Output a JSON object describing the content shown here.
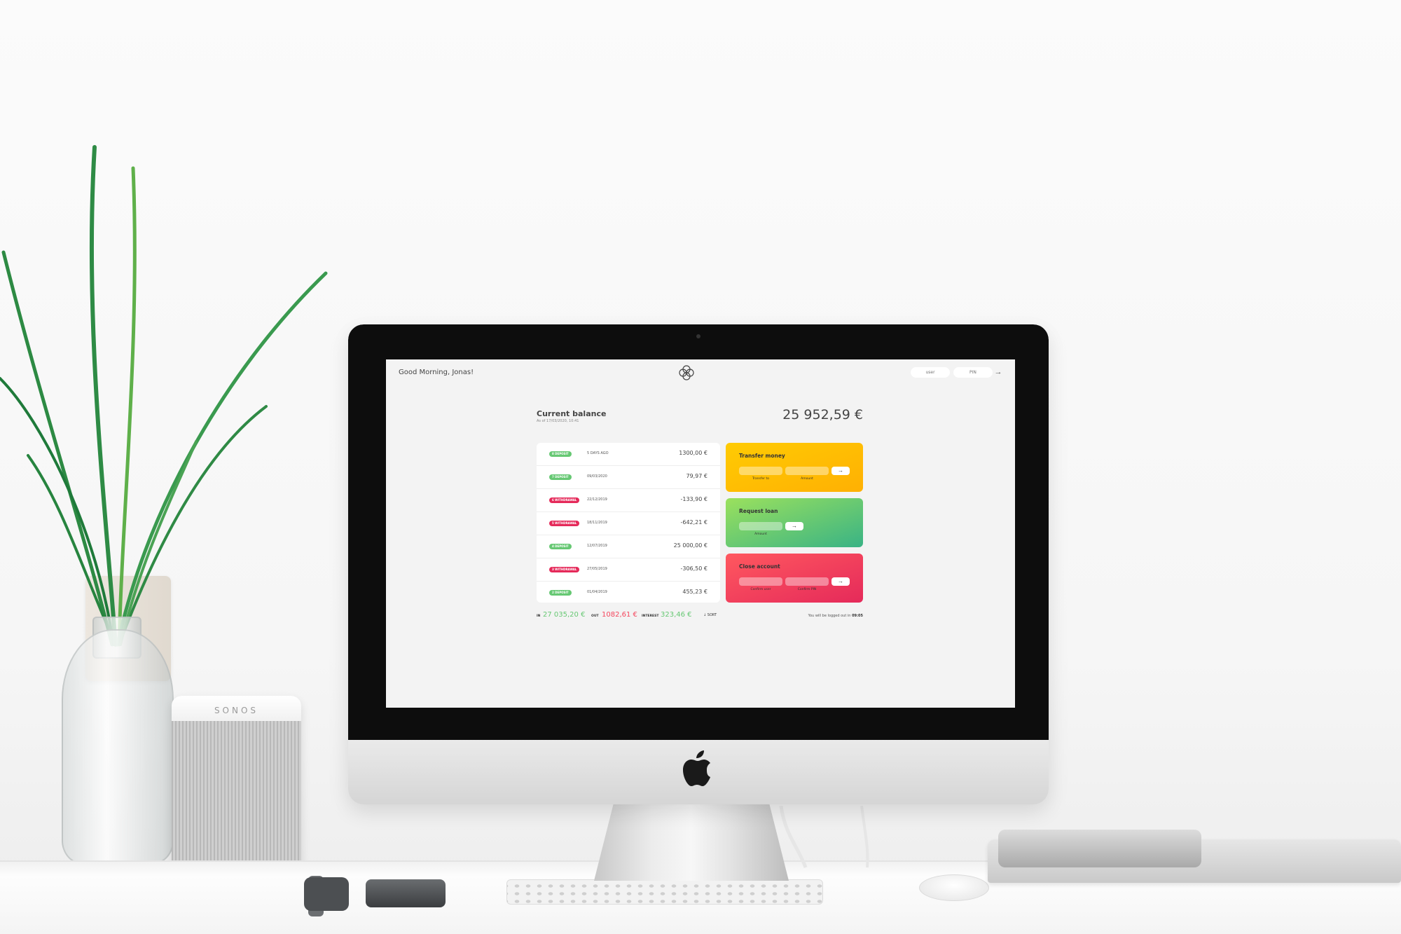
{
  "scene": {
    "speaker_brand": "SONOS"
  },
  "app": {
    "greeting": "Good Morning, Jonas!",
    "login": {
      "user_placeholder": "user",
      "pin_placeholder": "PIN",
      "button_icon": "arrow-right-icon"
    },
    "balance": {
      "label": "Current balance",
      "date": "As of 17/03/2020, 10:41",
      "value": "25 952,59 €"
    },
    "movements": [
      {
        "type": "8 DEPOSIT",
        "kind": "deposit",
        "date": "5 DAYS AGO",
        "value": "1300,00 €"
      },
      {
        "type": "7 DEPOSIT",
        "kind": "deposit",
        "date": "09/03/2020",
        "value": "79,97 €"
      },
      {
        "type": "6 WITHDRAWAL",
        "kind": "withdrawal",
        "date": "22/12/2019",
        "value": "-133,90 €"
      },
      {
        "type": "5 WITHDRAWAL",
        "kind": "withdrawal",
        "date": "18/11/2019",
        "value": "-642,21 €"
      },
      {
        "type": "4 DEPOSIT",
        "kind": "deposit",
        "date": "12/07/2019",
        "value": "25 000,00 €"
      },
      {
        "type": "3 WITHDRAWAL",
        "kind": "withdrawal",
        "date": "27/05/2019",
        "value": "-306,50 €"
      },
      {
        "type": "2 DEPOSIT",
        "kind": "deposit",
        "date": "01/04/2019",
        "value": "455,23 €"
      }
    ],
    "operations": {
      "transfer": {
        "title": "Transfer money",
        "label_to": "Transfer to",
        "label_amount": "Amount"
      },
      "loan": {
        "title": "Request loan",
        "label_amount": "Amount"
      },
      "close": {
        "title": "Close account",
        "label_user": "Confirm user",
        "label_pin": "Confirm PIN"
      }
    },
    "summary": {
      "in_label": "IN",
      "in_value": "27 035,20 €",
      "out_label": "OUT",
      "out_value": "1082,61 €",
      "interest_label": "INTEREST",
      "interest_value": "323,46 €",
      "sort_label": "↓ SORT",
      "logout_text": "You will be logged out in",
      "logout_timer": "09:05"
    },
    "colors": {
      "deposit": "#39b385",
      "withdrawal": "#e52a5a",
      "positive_text": "#66c873",
      "negative_text": "#f5465d"
    }
  }
}
